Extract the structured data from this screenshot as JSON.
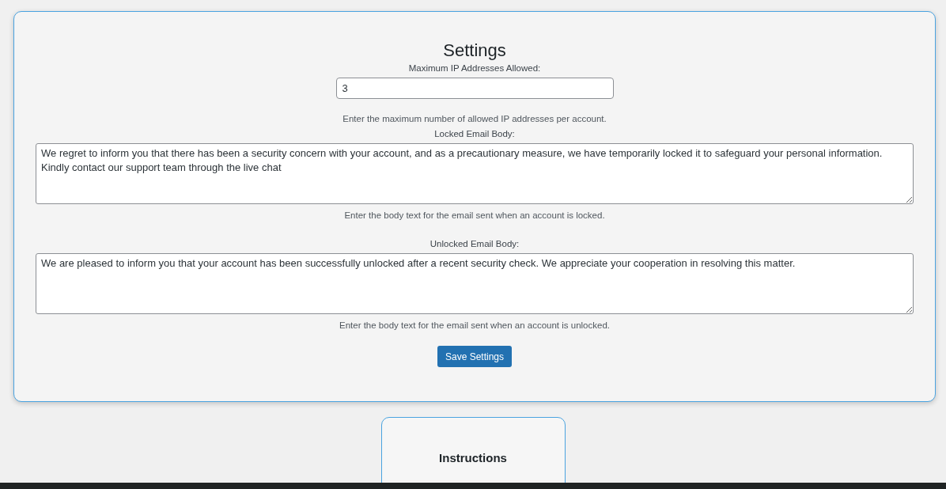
{
  "settings": {
    "title": "Settings",
    "fields": [
      {
        "kind": "input",
        "label": "Maximum IP Addresses Allowed:",
        "value": "3",
        "help": "Enter the maximum number of allowed IP addresses per account."
      },
      {
        "kind": "textarea",
        "label": "Locked Email Body:",
        "value": "We regret to inform you that there has been a security concern with your account, and as a precautionary measure, we have temporarily locked it to safeguard your personal information. Kindly contact our support team through the live chat",
        "help": "Enter the body text for the email sent when an account is locked."
      },
      {
        "kind": "textarea",
        "label": "Unlocked Email Body:",
        "value": "We are pleased to inform you that your account has been successfully unlocked after a recent security check. We appreciate your cooperation in resolving this matter.",
        "help": "Enter the body text for the email sent when an account is unlocked."
      }
    ],
    "button": "Save Settings"
  },
  "instructions": {
    "title": "Instructions"
  }
}
